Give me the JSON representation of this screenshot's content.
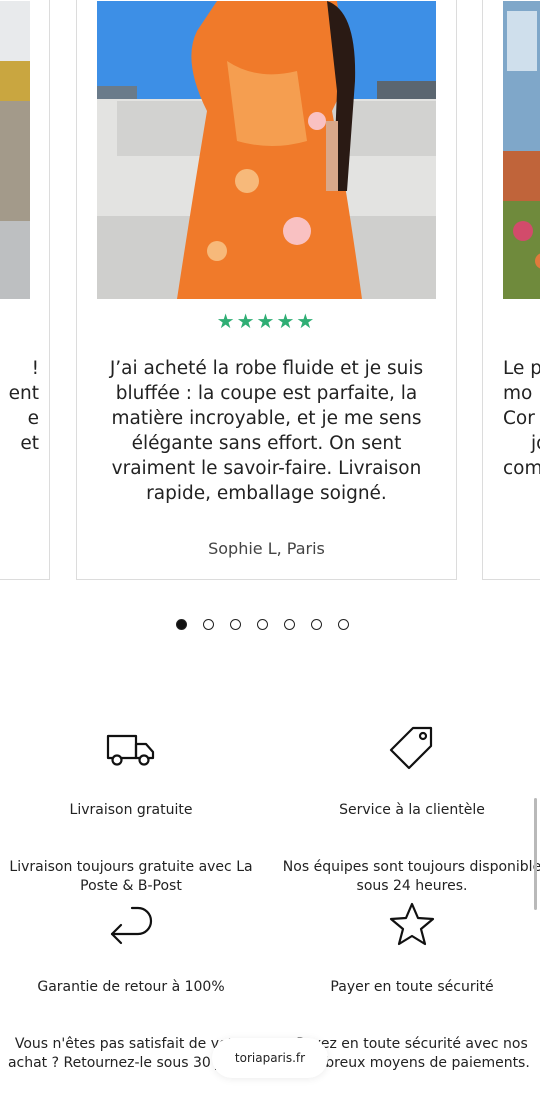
{
  "carousel": {
    "left_card": {
      "lines": [
        "!",
        "ent",
        "e",
        "et"
      ]
    },
    "center_card": {
      "rating": "★★★★★",
      "review": "J’ai acheté la robe fluide et je suis bluffée : la coupe est parfaite, la matière incroyable, et je me sens élégante sans effort. On sent vraiment le savoir-faire. Livraison rapide, emballage soigné.",
      "author": "Sophie L, Paris"
    },
    "right_card": {
      "lines": [
        "Le p",
        "mo",
        "Cor",
        "jo",
        "com"
      ]
    },
    "dots": {
      "count": 7,
      "active_index": 0
    }
  },
  "features": [
    {
      "icon": "truck-icon",
      "title": "Livraison gratuite",
      "desc": "Livraison toujours gratuite avec La Poste & B-Post"
    },
    {
      "icon": "tag-icon",
      "title": "Service à la clientèle",
      "desc": "Nos équipes sont toujours disponible sous 24 heures."
    },
    {
      "icon": "return-arrow-icon",
      "title": "Garantie de retour à 100%",
      "desc": "Vous n'êtes pas satisfait de votre achat ? Retournez-le sous 30 jours."
    },
    {
      "icon": "star-icon",
      "title": "Payer en toute sécurité",
      "desc": "Payez en toute sécurité avec nos nombreux moyens de paiements."
    }
  ],
  "browser": {
    "url": "toriaparis.fr"
  },
  "colors": {
    "stars": "#2fae74",
    "border": "#dcdcdc",
    "dress_orange": "#f07a2a",
    "sky": "#3d8fe6"
  }
}
